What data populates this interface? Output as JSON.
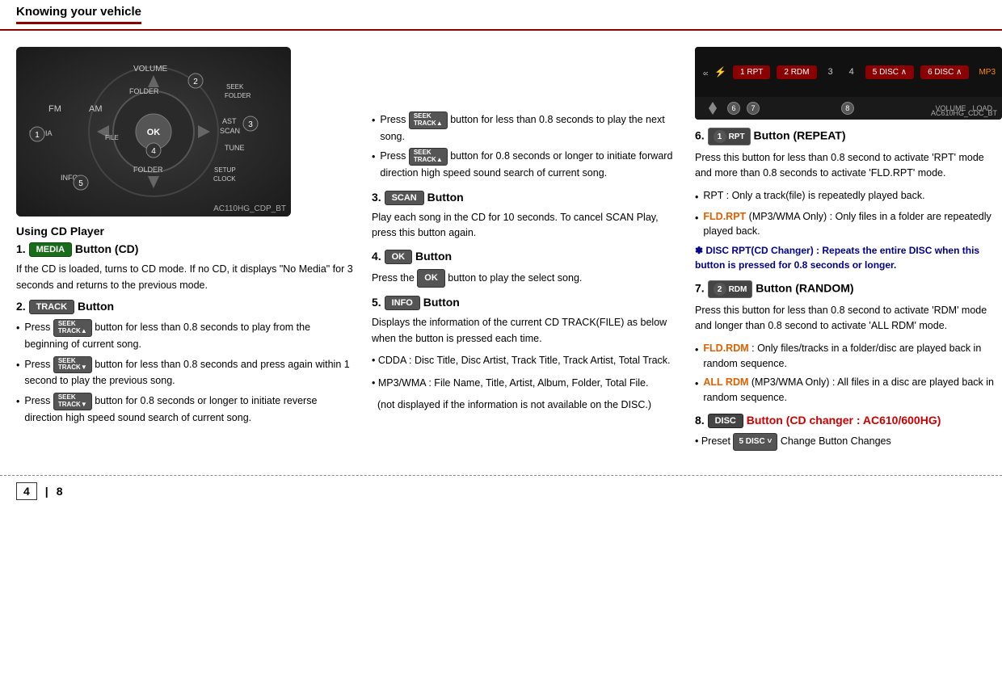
{
  "header": {
    "title": "Knowing your vehicle"
  },
  "left": {
    "image_caption": "AC110HG_CDP_BT",
    "section_title": "Using CD Player",
    "s1_title": "1.",
    "s1_btn": "MEDIA",
    "s1_heading": "Button (CD)",
    "s1_body": "If the CD is loaded, turns to CD mode. If no CD, it displays \"No Media\" for 3 seconds and returns to the previous mode.",
    "s2_title": "2.",
    "s2_btn": "TRACK",
    "s2_heading": "Button",
    "s2_bullet1": "Press",
    "s2_bullet1b": "button for less than 0.8 seconds to play from the beginning of current song.",
    "s2_bullet2": "Press",
    "s2_bullet2b": "button for less than 0.8 seconds and press again within 1 second to play the previous song.",
    "s2_bullet3": "Press",
    "s2_bullet3b": "button for 0.8 seconds or longer to initiate reverse direction high speed sound search of current song."
  },
  "center": {
    "c1_bullet1_pre": "Press",
    "c1_bullet1_post": "button for less than 0.8 seconds to play the next song.",
    "c1_bullet2_pre": "Press",
    "c1_bullet2_post": "button for 0.8 seconds or longer to initiate forward direction high speed sound search of current song.",
    "s3_num": "3.",
    "s3_btn": "SCAN",
    "s3_heading": "Button",
    "s3_body": "Play each song in the CD for 10 seconds. To cancel SCAN Play, press this button again.",
    "s4_num": "4.",
    "s4_btn": "OK",
    "s4_heading": "Button",
    "s4_body_pre": "Press the",
    "s4_body_mid": "OK",
    "s4_body_post": "button to play the select song.",
    "s5_num": "5.",
    "s5_btn": "INFO",
    "s5_heading": "Button",
    "s5_body": "Displays the information of the current CD TRACK(FILE) as below when the button is pressed each time.",
    "s5_bullet1": "CDDA : Disc Title, Disc Artist, Track Title, Track Artist, Total Track.",
    "s5_bullet2": "MP3/WMA : File Name, Title, Artist, Album, Folder, Total File.",
    "s5_bullet3": "(not displayed if the information is not available on the DISC.)"
  },
  "right": {
    "image_caption": "AC610HG_CDC_BT",
    "right_num6": "6",
    "right_num7": "7",
    "right_num8": "8",
    "s6_num": "6.",
    "s6_btn": "1 RPT",
    "s6_heading": "Button (REPEAT)",
    "s6_body": "Press this button for less than 0.8 second to activate 'RPT' mode and more than 0.8 seconds to activate 'FLD.RPT' mode.",
    "s6_b1": "RPT : Only a track(file) is repeatedly played back.",
    "s6_b2_pre": "FLD.RPT",
    "s6_b2_post": "(MP3/WMA Only) : Only files in a folder are repeatedly played back.",
    "s6_note": "✽ DISC RPT(CD Changer) : Repeats the entire DISC when this button is pressed for 0.8 seconds or longer.",
    "s7_num": "7.",
    "s7_btn": "2 RDM",
    "s7_heading": "Button (RANDOM)",
    "s7_body": "Press this button for less than 0.8 second to activate 'RDM' mode and longer than 0.8 second to activate 'ALL RDM' mode.",
    "s7_b1_pre": "FLD.RDM",
    "s7_b1_post": ": Only files/tracks in a folder/disc are played back in random sequence.",
    "s7_b2_pre": "ALL RDM",
    "s7_b2_post": "(MP3/WMA Only) : All files in a disc are played back in random sequence.",
    "s8_num": "8.",
    "s8_btn": "DISC",
    "s8_heading": "Button (CD changer : AC610/600HG)",
    "s8_body_pre": "• Preset",
    "s8_body_btn": "5 DISC ˅",
    "s8_body_post": "Change Button Changes"
  },
  "footer": {
    "page_left": "4",
    "sep": "8",
    "page_right": "8"
  },
  "labels": {
    "seek_track_up": "SEEK\nTRACK▲",
    "seek_track_down": "SEEK\nTRACK▼",
    "ok_btn": "OK",
    "volume_label": "VOLUME",
    "ri_1rpt": "1 RPT",
    "ri_2rdm": "2 RDM",
    "ri_3": "3",
    "ri_4": "4",
    "ri_5disc": "5 DISC ∧",
    "ri_6disc": "6 DISC ∧",
    "ri_load": "LOAD",
    "ri_volume": "VOLUME"
  }
}
